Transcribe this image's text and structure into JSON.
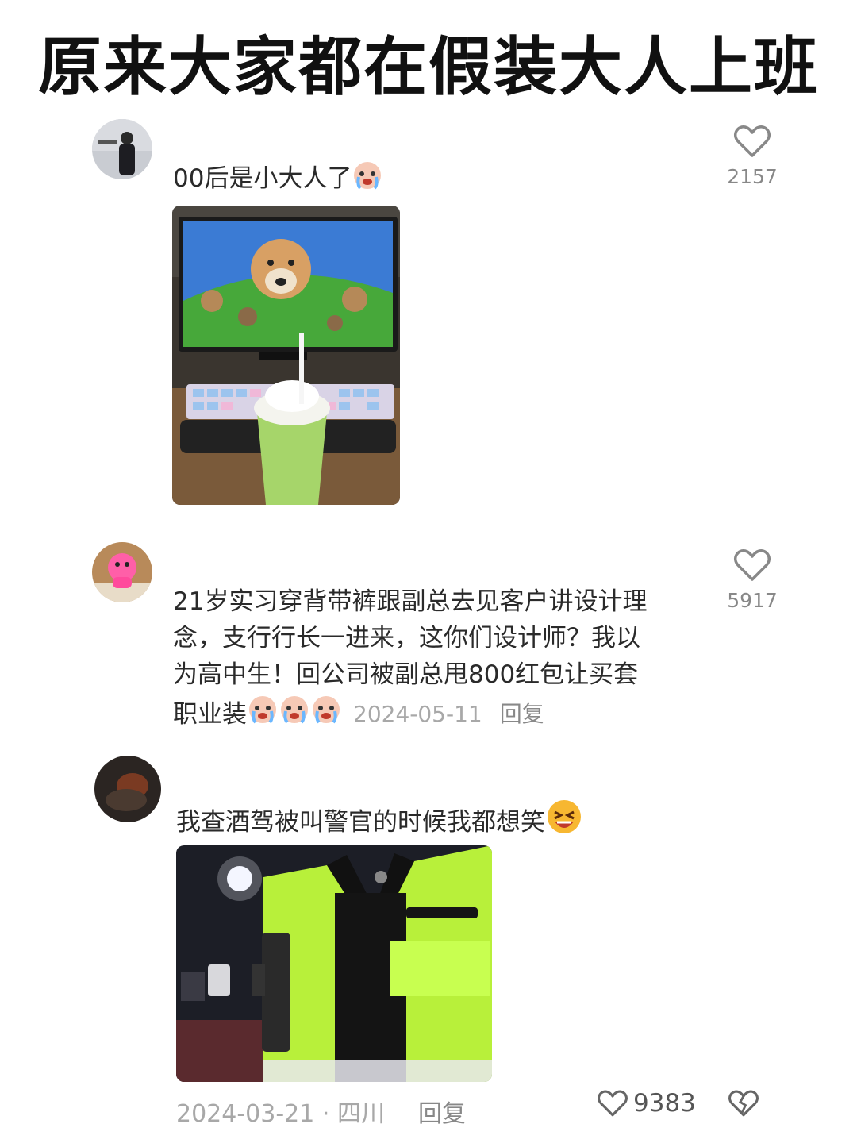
{
  "title": "原来大家都在假装大人上班",
  "comments": [
    {
      "text": "00后是小大人了",
      "emoji": "crying-face-emoji",
      "likes": "2157"
    },
    {
      "text_line1": "21岁实习穿背带裤跟副总去见客户讲设计理",
      "text_line2": "念，支行行长一进来，这你们设计师？我以",
      "text_line3": "为高中生！回公司被副总甩800红包让买套",
      "text_line4": "职业装",
      "emoji": "crying-face-emoji",
      "date": "2024-05-11",
      "reply": "回复",
      "likes": "5917"
    },
    {
      "text": "我查酒驾被叫警官的时候我都想笑",
      "emoji": "laughing-face-emoji",
      "date": "2024-03-21 · 四川",
      "reply": "回复",
      "likes": "9383"
    }
  ],
  "icons": {
    "like": "heart-outline-icon",
    "dislike": "broken-heart-icon"
  },
  "colors": {
    "count": "#888888",
    "title": "#111111",
    "vest": "#b8f03a"
  }
}
